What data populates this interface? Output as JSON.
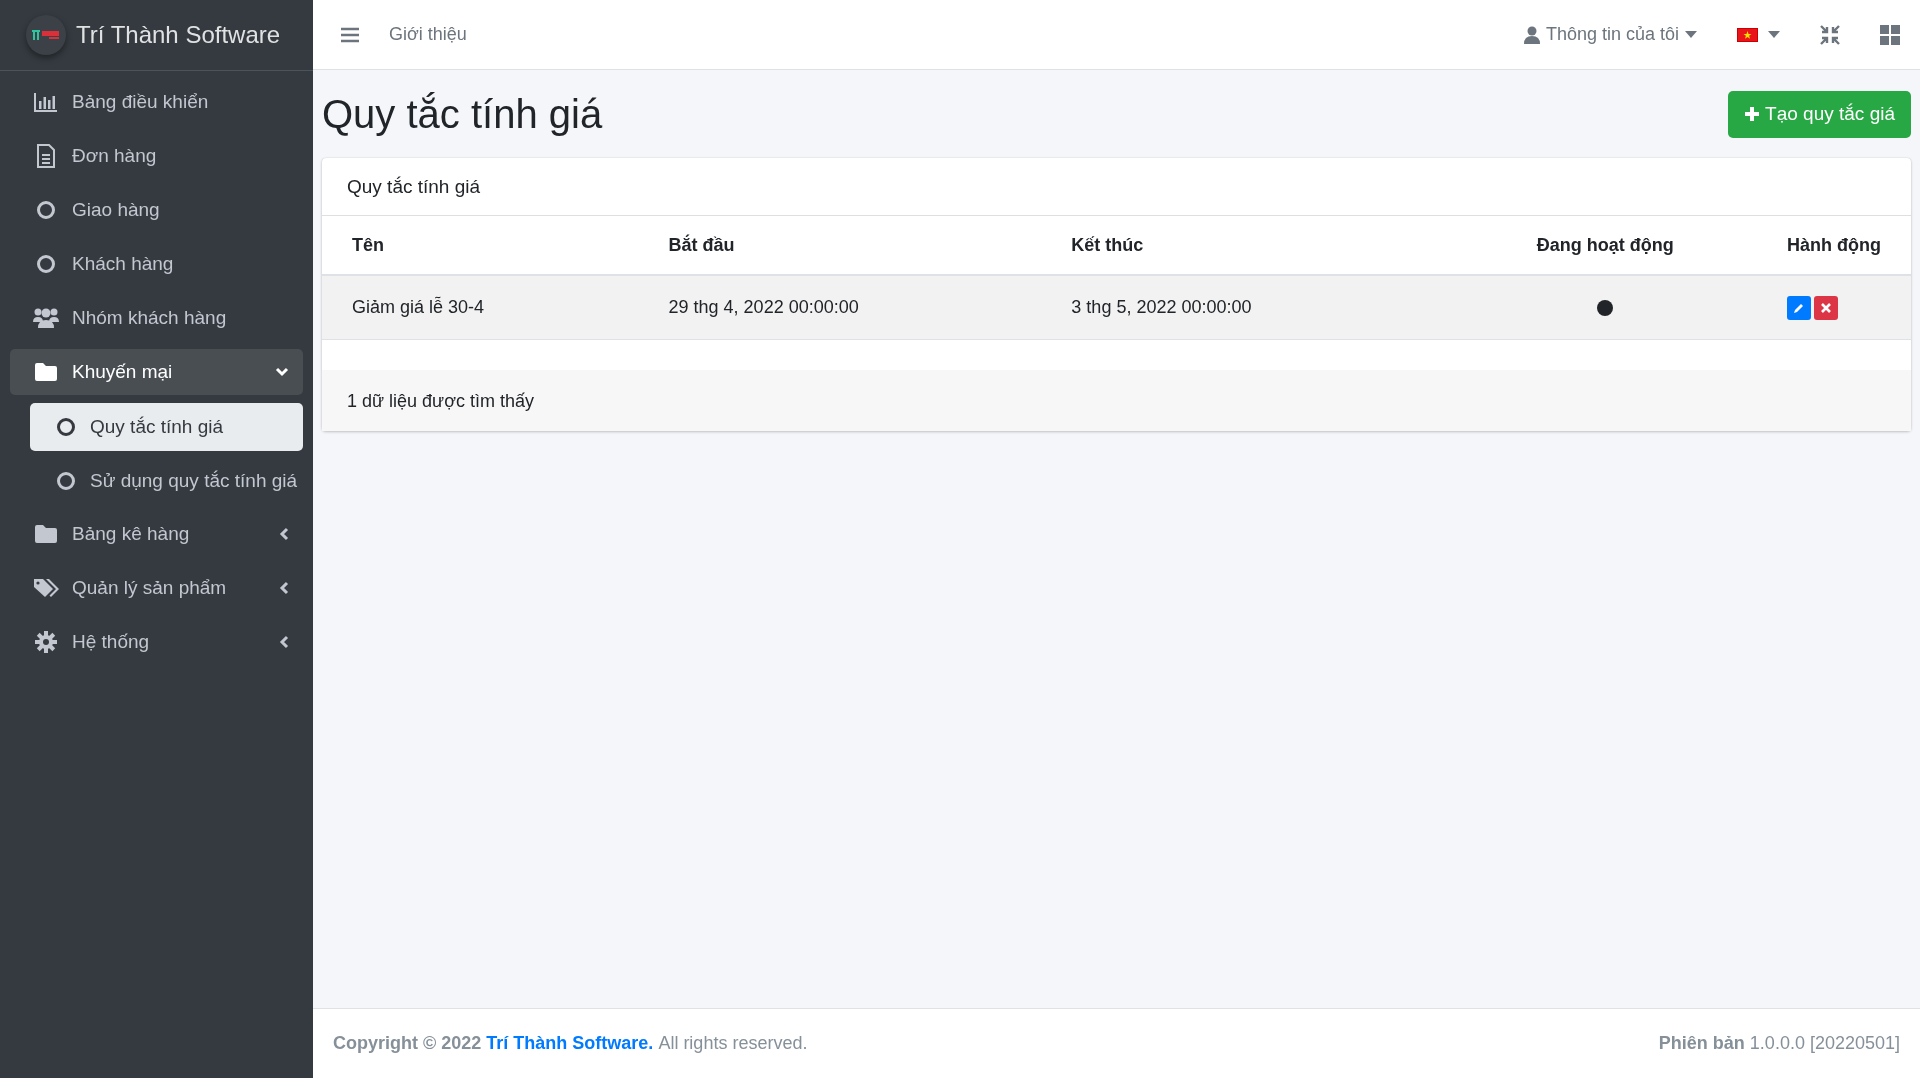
{
  "brand": {
    "name": "Trí Thành Software"
  },
  "sidebar": {
    "items": [
      {
        "label": "Bảng điều khiển",
        "kind": "link"
      },
      {
        "label": "Đơn hàng",
        "kind": "link"
      },
      {
        "label": "Giao hàng",
        "kind": "link"
      },
      {
        "label": "Khách hàng",
        "kind": "link"
      },
      {
        "label": "Nhóm khách hàng",
        "kind": "link"
      },
      {
        "label": "Khuyến mại",
        "kind": "group",
        "expanded": true,
        "children": [
          {
            "label": "Quy tắc tính giá",
            "selected": true
          },
          {
            "label": "Sử dụng quy tắc tính giá",
            "selected": false
          }
        ]
      },
      {
        "label": "Bảng kê hàng",
        "kind": "group",
        "expanded": false
      },
      {
        "label": "Quản lý sản phẩm",
        "kind": "group",
        "expanded": false
      },
      {
        "label": "Hệ thống",
        "kind": "group",
        "expanded": false
      }
    ]
  },
  "topbar": {
    "nav_link": "Giới thiệu",
    "user_menu": "Thông tin của tôi"
  },
  "page": {
    "title": "Quy tắc tính giá",
    "create_button": "Tạo quy tắc giá"
  },
  "card": {
    "title": "Quy tắc tính giá",
    "table": {
      "columns": [
        "Tên",
        "Bắt đầu",
        "Kết thúc",
        "Đang hoạt động",
        "Hành động"
      ],
      "rows": [
        {
          "name": "Giảm giá lễ 30-4",
          "start": "29 thg 4, 2022 00:00:00",
          "end": "3 thg 5, 2022 00:00:00",
          "active": true
        }
      ]
    },
    "footer": "1 dữ liệu được tìm thấy"
  },
  "footer": {
    "copyright": "Copyright © 2022",
    "company_link": "Trí Thành Software.",
    "rights": "All rights reserved.",
    "version_label": "Phiên bản",
    "version": "1.0.0.0 [20220501]"
  }
}
